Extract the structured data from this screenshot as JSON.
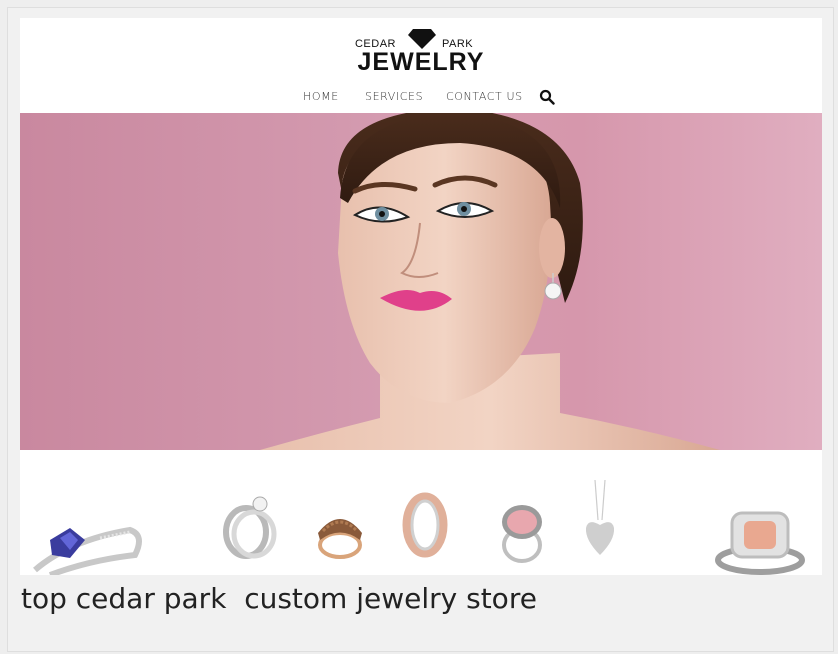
{
  "brand": {
    "logo_top_left": "CEDAR",
    "logo_top_right": "PARK",
    "logo_main": "JEWELRY"
  },
  "nav": {
    "items": [
      {
        "label": "HOME"
      },
      {
        "label": "SERVICES"
      },
      {
        "label": "CONTACT US"
      }
    ],
    "search_icon": "search-icon"
  },
  "hero": {
    "background_color": "#d49bb0",
    "lip_color": "#e0408a"
  },
  "products": [
    {
      "name": "tanzanite-ring"
    },
    {
      "name": "wedding-ring-set"
    },
    {
      "name": "champagne-diamond-ring"
    },
    {
      "name": "two-tone-band"
    },
    {
      "name": "pink-stone-ring"
    },
    {
      "name": "heart-pendant"
    },
    {
      "name": "morganite-halo-ring"
    }
  ],
  "caption": "top cedar park  custom jewelry store"
}
